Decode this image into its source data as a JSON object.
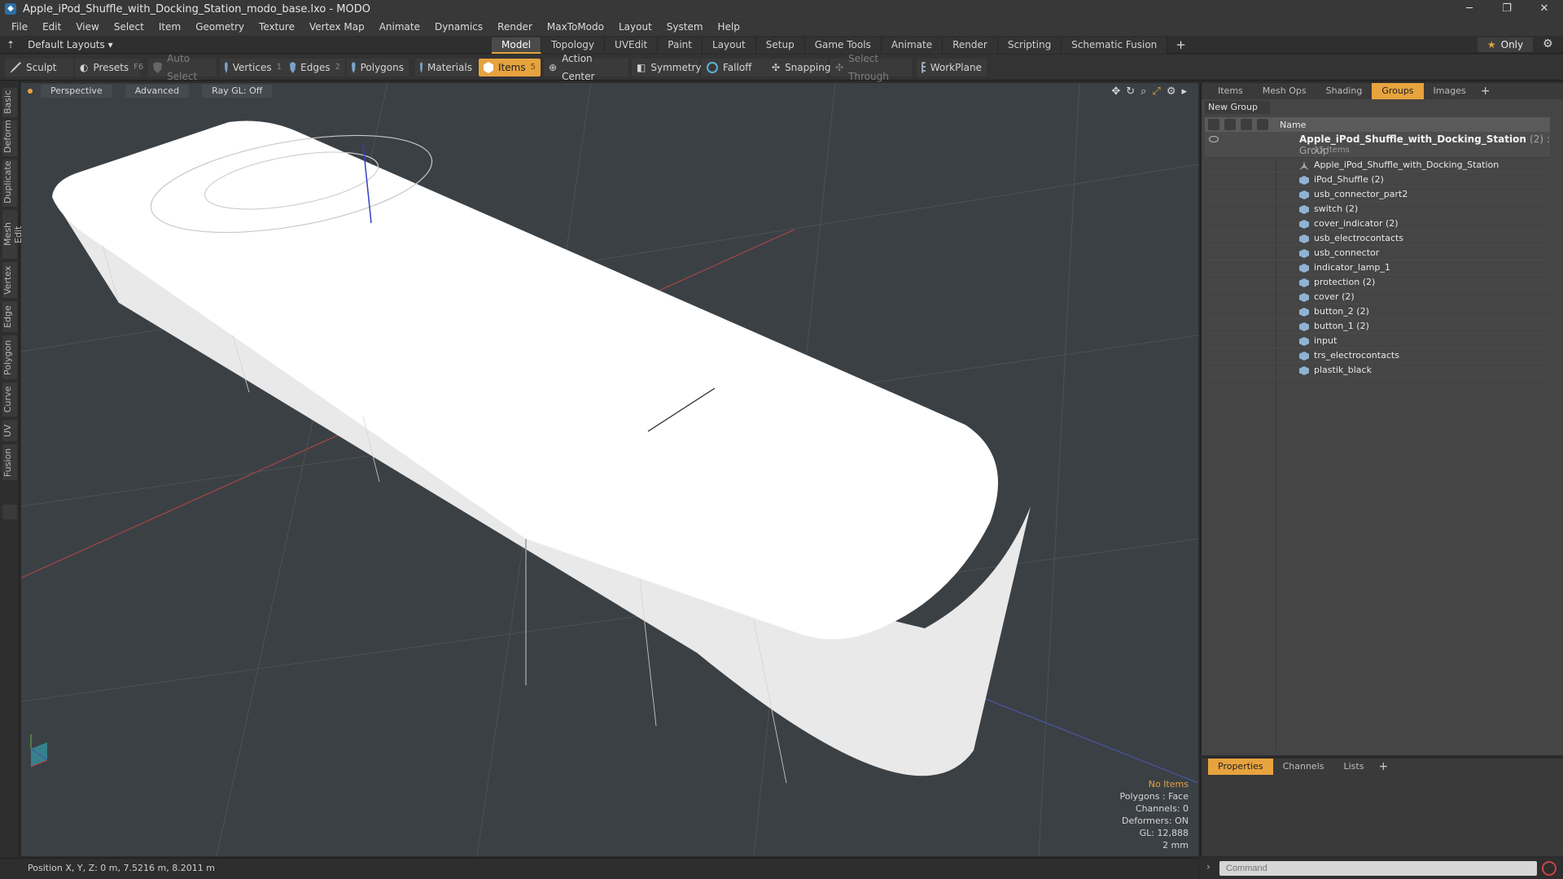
{
  "window": {
    "title": "Apple_iPod_Shuffle_with_Docking_Station_modo_base.lxo - MODO",
    "controls": [
      "─",
      "❐",
      "✕"
    ]
  },
  "menu": [
    "File",
    "Edit",
    "View",
    "Select",
    "Item",
    "Geometry",
    "Texture",
    "Vertex Map",
    "Animate",
    "Dynamics",
    "Render",
    "MaxToModo",
    "Layout",
    "System",
    "Help"
  ],
  "layoutbar": {
    "layout_label": "Default Layouts ▾",
    "tabs": [
      "Model",
      "Topology",
      "UVEdit",
      "Paint",
      "Layout",
      "Setup",
      "Game Tools",
      "Animate",
      "Render",
      "Scripting",
      "Schematic Fusion"
    ],
    "active_tab": "Model",
    "add_tab": "+",
    "only_label": "Only"
  },
  "toolbar": {
    "sculpt": "Sculpt",
    "presets": "Presets",
    "presets_key": "F6",
    "auto_select": "Auto Select",
    "vertices": "Vertices",
    "vertices_key": "1",
    "edges": "Edges",
    "edges_key": "2",
    "polygons": "Polygons",
    "materials": "Materials",
    "items": "Items",
    "items_key": "5",
    "action_center": "Action Center",
    "symmetry": "Symmetry",
    "falloff": "Falloff",
    "snapping": "Snapping",
    "select_through": "Select Through",
    "workplane": "WorkPlane"
  },
  "left_tabs": [
    "Basic",
    "Deform",
    "Duplicate",
    "Mesh Edit",
    "Vertex",
    "Edge",
    "Polygon",
    "Curve",
    "UV",
    "Fusion"
  ],
  "viewport": {
    "perspective": "Perspective",
    "advanced": "Advanced",
    "raygl": "Ray GL: Off",
    "info": {
      "no_items": "No Items",
      "polygons": "Polygons : Face",
      "channels": "Channels: 0",
      "deformers": "Deformers: ON",
      "gl": "GL: 12,888",
      "scale": "2 mm"
    }
  },
  "status": {
    "position": "Position X, Y, Z:  0 m, 7.5216 m, 8.2011 m"
  },
  "right_panel": {
    "tabs": [
      "Items",
      "Mesh Ops",
      "Shading",
      "Groups",
      "Images"
    ],
    "active_tab": "Groups",
    "add_tab": "+",
    "new_group": "New Group",
    "col_name": "Name",
    "group": {
      "name": "Apple_iPod_Shuffle_with_Docking_Station",
      "count": "(2) : Group",
      "subtitle": "15 Items"
    },
    "items": [
      "Apple_iPod_Shuffle_with_Docking_Station",
      "iPod_Shuffle (2)",
      "usb_connector_part2",
      "switch (2)",
      "cover_indicator (2)",
      "usb_electrocontacts",
      "usb_connector",
      "indicator_lamp_1",
      "protection (2)",
      "cover (2)",
      "button_2 (2)",
      "button_1 (2)",
      "input",
      "trs_electrocontacts",
      "plastik_black"
    ]
  },
  "props_panel": {
    "tabs": [
      "Properties",
      "Channels",
      "Lists"
    ],
    "active_tab": "Properties",
    "add_tab": "+"
  },
  "command": {
    "placeholder": "Command"
  },
  "colors": {
    "accent": "#e7a33e",
    "viewport_bg": "#3b4045",
    "panel_bg": "#454545"
  }
}
